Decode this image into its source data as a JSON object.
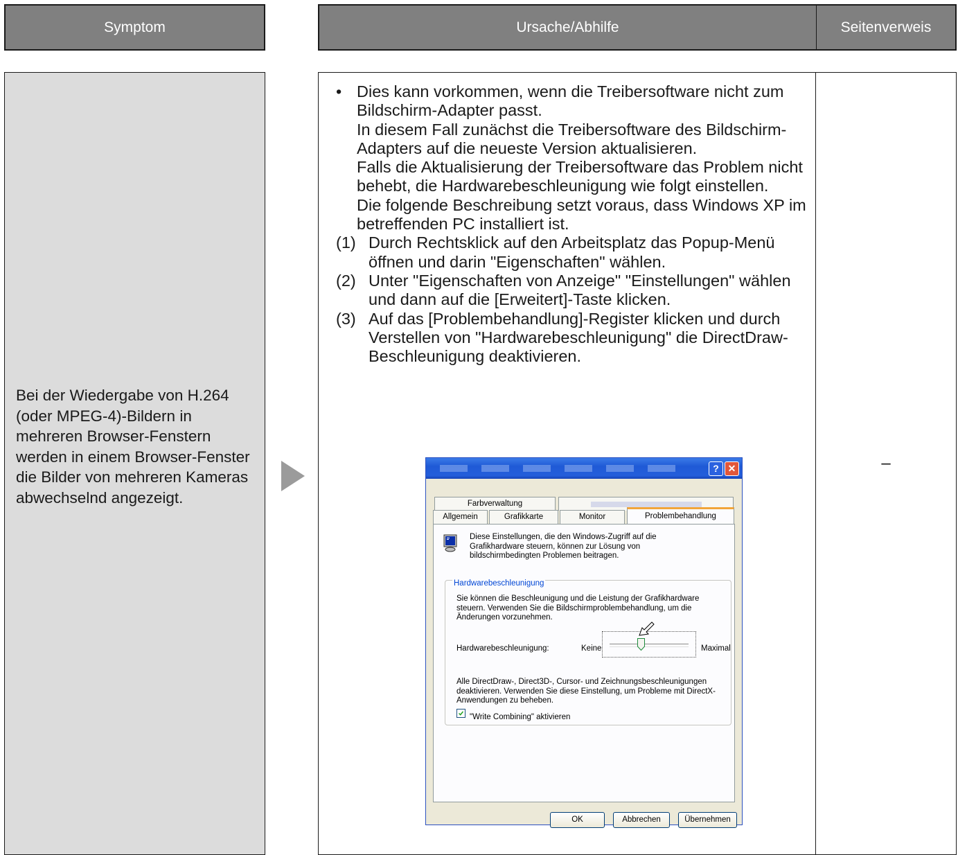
{
  "headers": {
    "symptom": "Symptom",
    "cause": "Ursache/Abhilfe",
    "reference": "Seitenverweis"
  },
  "symptom_text": "Bei der Wiedergabe von H.264 (oder MPEG-4)-Bildern in mehreren Browser-Fenstern werden in einem Browser-Fenster die Bilder von mehreren Kameras abwechselnd angezeigt.",
  "cause": {
    "bullet": "•",
    "paragraphs": [
      "Dies kann vorkommen, wenn die Treibersoftware nicht zum Bildschirm-Adapter passt.",
      "In diesem Fall zunächst die Treibersoftware des Bildschirm-Adapters auf die neueste Version aktualisieren.",
      "Falls die Aktualisierung der Treibersoftware das Problem nicht behebt, die Hardwarebeschleunigung wie folgt einstellen.",
      "Die folgende Beschreibung setzt voraus, dass Windows XP im betreffenden PC installiert ist."
    ],
    "steps": [
      {
        "num": "(1)",
        "text": "Durch Rechtsklick auf den Arbeitsplatz das Popup-Menü öffnen und darin \"Eigenschaften\" wählen."
      },
      {
        "num": "(2)",
        "text": "Unter \"Eigenschaften von Anzeige\" \"Einstellungen\" wählen und dann auf die [Erweitert]-Taste klicken."
      },
      {
        "num": "(3)",
        "text": "Auf das [Problembehandlung]-Register klicken und durch Verstellen von \"Hardwarebeschleunigung\" die DirectDraw-Beschleunigung deaktivieren."
      }
    ]
  },
  "reference": "–",
  "dialog": {
    "help_label": "?",
    "close_label": "✕",
    "tabs": {
      "farbverwaltung": "Farbverwaltung",
      "allgemein": "Allgemein",
      "grafikkarte": "Grafikkarte",
      "monitor": "Monitor",
      "problembehandlung": "Problembehandlung"
    },
    "intro": "Diese Einstellungen, die den Windows-Zugriff auf die Grafikhardware steuern, können zur Lösung von bildschirmbedingten Problemen beitragen.",
    "group_title": "Hardwarebeschleunigung",
    "group_desc": "Sie können die Beschleunigung und die Leistung der Grafikhardware steuern. Verwenden Sie die Bildschirmproblembehandlung, um die Änderungen vorzunehmen.",
    "slider_label": "Hardwarebeschleunigung:",
    "slider_min": "Keine",
    "slider_max": "Maximal",
    "slider_level": 0.4,
    "warning": "Alle DirectDraw-, Direct3D-, Cursor- und Zeichnungsbeschleunigungen deaktivieren. Verwenden Sie diese Einstellung, um Probleme mit DirectX-Anwendungen zu beheben.",
    "checkbox_label": "\"Write Combining\" aktivieren",
    "checkbox_checked": true,
    "buttons": {
      "ok": "OK",
      "cancel": "Abbrechen",
      "apply": "Übernehmen"
    }
  },
  "colors": {
    "header_bg": "#808080",
    "symptom_bg": "#dcdcdc",
    "arrow": "#9b9b9b",
    "dialog_bg": "#ece9d8",
    "titlebar": "#245edb"
  }
}
